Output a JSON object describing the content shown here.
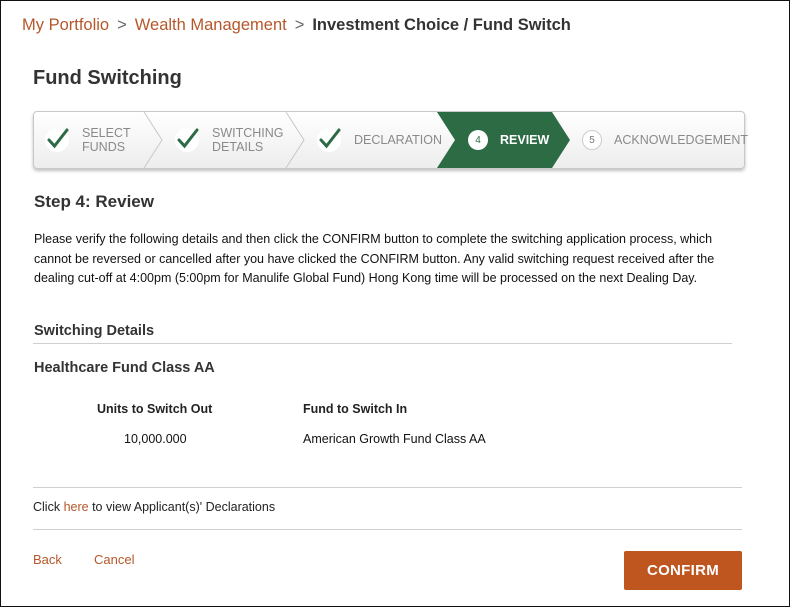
{
  "breadcrumb": {
    "items": [
      "My Portfolio",
      "Wealth Management"
    ],
    "separator": ">",
    "current": "Investment Choice / Fund Switch"
  },
  "page_title": "Fund Switching",
  "wizard": {
    "steps": [
      {
        "label_line1": "SELECT",
        "label_line2": "FUNDS",
        "status": "completed",
        "icon": "check-icon"
      },
      {
        "label_line1": "SWITCHING",
        "label_line2": "DETAILS",
        "status": "completed",
        "icon": "check-icon"
      },
      {
        "label_line1": "DECLARATION",
        "label_line2": "",
        "status": "completed",
        "icon": "check-icon"
      },
      {
        "number": "4",
        "label_line1": "REVIEW",
        "label_line2": "",
        "status": "active"
      },
      {
        "number": "5",
        "label_line1": "ACKNOWLEDGEMENT",
        "label_line2": "",
        "status": "upcoming"
      }
    ],
    "colors": {
      "active": "#2c6b44",
      "check": "#2c6b44"
    }
  },
  "review": {
    "heading": "Step 4: Review",
    "instructions": "Please verify the following details and then click the CONFIRM button to complete the switching application process, which cannot be reversed or cancelled after you have clicked the CONFIRM button. Any valid switching request received after the dealing cut-off at 4:00pm (5:00pm for Manulife Global Fund) Hong Kong time will be processed on the next Dealing Day."
  },
  "switching_details": {
    "heading": "Switching Details",
    "fund_name": "Healthcare Fund Class AA",
    "columns": [
      "Units to Switch Out",
      "Fund to Switch In"
    ],
    "rows": [
      [
        "10,000.000",
        "American Growth Fund Class AA"
      ]
    ]
  },
  "declaration": {
    "prefix": "Click ",
    "link": "here",
    "suffix": " to view Applicant(s)' Declarations"
  },
  "actions": {
    "back": "Back",
    "cancel": "Cancel",
    "confirm": "CONFIRM"
  },
  "colors": {
    "accent": "#c0561f",
    "link": "#b5572a"
  }
}
